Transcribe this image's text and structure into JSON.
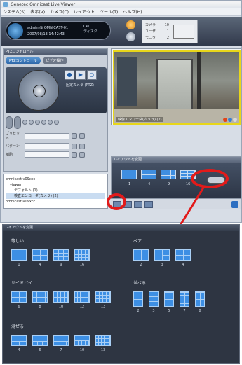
{
  "app": {
    "title": "Genetec Omnicast Live Viewer"
  },
  "menu": [
    "システム(S)",
    "表示(V)",
    "カメラ(C)",
    "レイアウト",
    "ツール(T)",
    "ヘルプ(H)"
  ],
  "header": {
    "user": "admin @ OMNICAST-01",
    "datetime": "2007/08/13 14:42:43",
    "cpu_label": "CPU",
    "cpu_value": "1",
    "disk_label": "ディスク",
    "stats": [
      {
        "label": "カメラ",
        "value": "10"
      },
      {
        "label": "ユーザ",
        "value": "1"
      },
      {
        "label": "モニタ",
        "value": "2"
      }
    ]
  },
  "left_panel": {
    "title": "PTZコントロール",
    "tabs": [
      "PTZコントロール",
      "ビデオ操作"
    ],
    "ptz_label": "固定カメラ (PTZ)",
    "fields": [
      {
        "label": "プリセット"
      },
      {
        "label": "パターン"
      },
      {
        "label": "補助"
      }
    ]
  },
  "tree": {
    "items": [
      "omnicast-v09xcc",
      "viewer",
      "デフォルト (1)",
      "検査エンコーダ(カメラ) (2)",
      "omnicast-v09xcc"
    ]
  },
  "video": {
    "label": "映像エンコーダ(カメラ) (2)"
  },
  "layout_panel": {
    "title": "レイアウトを変更",
    "numbers": [
      "1",
      "4",
      "9",
      "16"
    ]
  },
  "dialog": {
    "title": "レイアウトを変更",
    "groups": [
      {
        "name": "等しい",
        "labels": [
          "1",
          "4",
          "9",
          "16"
        ]
      },
      {
        "name": "ペア",
        "labels": [
          "2",
          "3",
          "4"
        ]
      },
      {
        "name": "サイドバイ",
        "labels": [
          "6",
          "8",
          "10",
          "12",
          "13"
        ]
      },
      {
        "name": "並べる",
        "labels": [
          "2",
          "3",
          "5",
          "7",
          "8"
        ]
      },
      {
        "name": "混ぜる",
        "labels": [
          "4",
          "6",
          "7",
          "10",
          "13"
        ]
      }
    ]
  },
  "colors": {
    "accent": "#3d8fe4",
    "highlight": "#e21a1a",
    "selection_frame": "#e8d61a"
  }
}
